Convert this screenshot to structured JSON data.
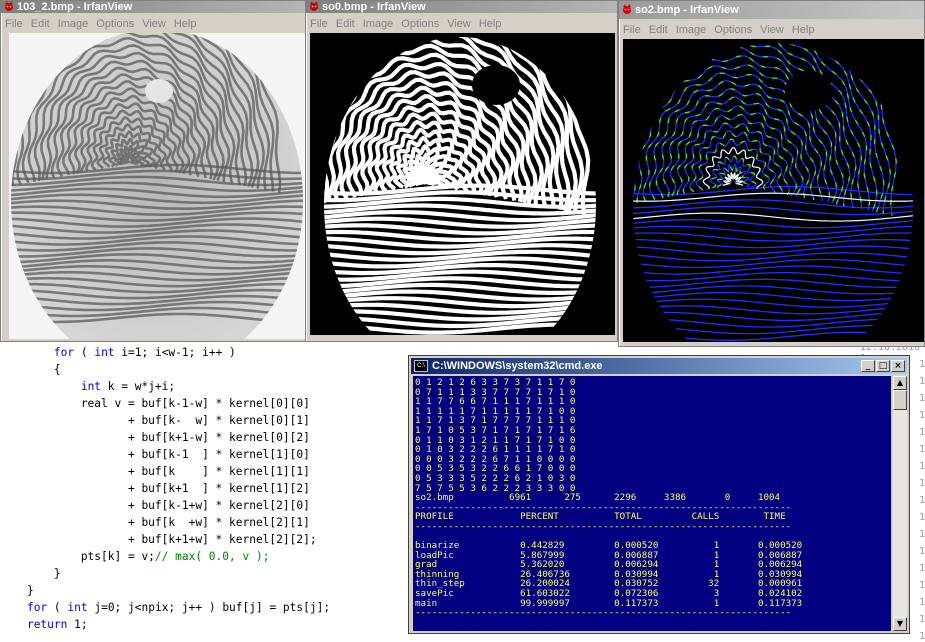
{
  "irfan_menu": [
    "File",
    "Edit",
    "Image",
    "Options",
    "View",
    "Help"
  ],
  "windows": [
    {
      "title": "103_2.bmp - IrfanView"
    },
    {
      "title": "so0.bmp - IrfanView"
    },
    {
      "title": "so2.bmp - IrfanView"
    }
  ],
  "code": {
    "lines": [
      [
        {
          "t": "        "
        },
        {
          "t": "for",
          "k": "kw"
        },
        {
          "t": " ( "
        },
        {
          "t": "int",
          "k": "kw"
        },
        {
          "t": " i=1; i<w-1; i++ )"
        }
      ],
      [
        {
          "t": "        {"
        }
      ],
      [
        {
          "t": "            "
        },
        {
          "t": "int",
          "k": "kw"
        },
        {
          "t": " k = w*j+i;"
        }
      ],
      [
        {
          "t": "            real v = buf[k-1-w] * kernel[0][0]"
        }
      ],
      [
        {
          "t": "                   + buf[k-  w] * kernel[0][1]"
        }
      ],
      [
        {
          "t": "                   + buf[k+1-w] * kernel[0][2]"
        }
      ],
      [
        {
          "t": "                   + buf[k-1  ] * kernel[1][0]"
        }
      ],
      [
        {
          "t": "                   + buf[k    ] * kernel[1][1]"
        }
      ],
      [
        {
          "t": "                   + buf[k+1  ] * kernel[1][2]"
        }
      ],
      [
        {
          "t": "                   + buf[k-1+w] * kernel[2][0]"
        }
      ],
      [
        {
          "t": "                   + buf[k  +w] * kernel[2][1]"
        }
      ],
      [
        {
          "t": "                   + buf[k+1+w] * kernel[2][2];"
        }
      ],
      [
        {
          "t": "            pts[k] = v;"
        },
        {
          "t": "// max( 0.0, v );",
          "k": "cm"
        }
      ],
      [
        {
          "t": "        }"
        }
      ],
      [
        {
          "t": "    }"
        }
      ],
      [
        {
          "t": "    "
        },
        {
          "t": "for",
          "k": "kw"
        },
        {
          "t": " ( "
        },
        {
          "t": "int",
          "k": "kw"
        },
        {
          "t": " j=0; j<npix; j++ ) buf[j] = pts[j];"
        }
      ],
      [
        {
          "t": "    "
        },
        {
          "t": "return",
          "k": "kw"
        },
        {
          "t": " 1;"
        }
      ]
    ],
    "gutter": [
      "12.10.2010 1",
      "1",
      "1",
      "1",
      "1",
      "1",
      "1",
      "1",
      "1",
      "1",
      "1",
      "1",
      "1",
      "1",
      "1",
      "1",
      "1",
      "1"
    ]
  },
  "cmd": {
    "title": "C:\\WINDOWS\\system32\\cmd.exe",
    "buttons": {
      "minimize": "_",
      "maximize": "□",
      "close": "×"
    },
    "scroll_up": "▲",
    "scroll_down": "▼",
    "lines": [
      "0 1 2 1 2 6 3 3 7 3 7 1 1 7 0",
      "0 7 1 1 1 3 3 7 7 7 7 1 7 1 0",
      "1 1 7 7 6 6 7 1 1 1 7 1 1 1 0",
      "1 1 1 1 1 7 1 1 1 1 1 7 1 0 0",
      "1 1 7 1 3 7 1 7 7 7 7 1 1 1 0",
      "1 7 1 0 5 3 7 1 7 1 7 1 7 1 6",
      "0 1 1 0 3 1 2 1 1 7 1 7 1 0 0",
      "0 1 0 3 2 2 2 6 1 1 1 1 7 1 0",
      "0 0 0 3 2 2 2 6 7 1 1 0 0 0 0",
      "0 0 5 3 5 3 2 2 6 6 1 7 0 0 0",
      "0 5 3 3 3 5 2 2 2 6 2 1 0 3 0",
      "7 5 7 5 5 3 6 2 2 2 3 3 3 0 0",
      "so2.bmp          6961      275      2296     3386       0     1004",
      "--------------------------------------------------------------------",
      "PROFILE            PERCENT          TOTAL         CALLS        TIME",
      "--------------------------------------------------------------------",
      "",
      "binarize           0.442829         0.000520          1       0.000520",
      "loadPic            5.867999         0.006887          1       0.006887",
      "grad               5.362020         0.006294          1       0.006294",
      "thinning           26.406736        0.030994          1       0.030994",
      "thin_step          26.200024        0.030752         32       0.000961",
      "savePic            61.603022        0.072306          3       0.024102",
      "main               99.999997        0.117373          1       0.117373",
      "--------------------------------------------------------------------"
    ]
  },
  "colors": {
    "titlebar_active": "#0a246a",
    "titlebar_inactive": "#808080",
    "console_bg": "#000080",
    "console_fg": "#ffff66",
    "keyword": "#0000ff",
    "comment": "#008000",
    "ridge_blue": "#1f2fff",
    "ridge_green": "#35e835"
  },
  "icons": {
    "irfanview": "irfanview-cat-icon",
    "cmd": "cmd-console-icon"
  }
}
